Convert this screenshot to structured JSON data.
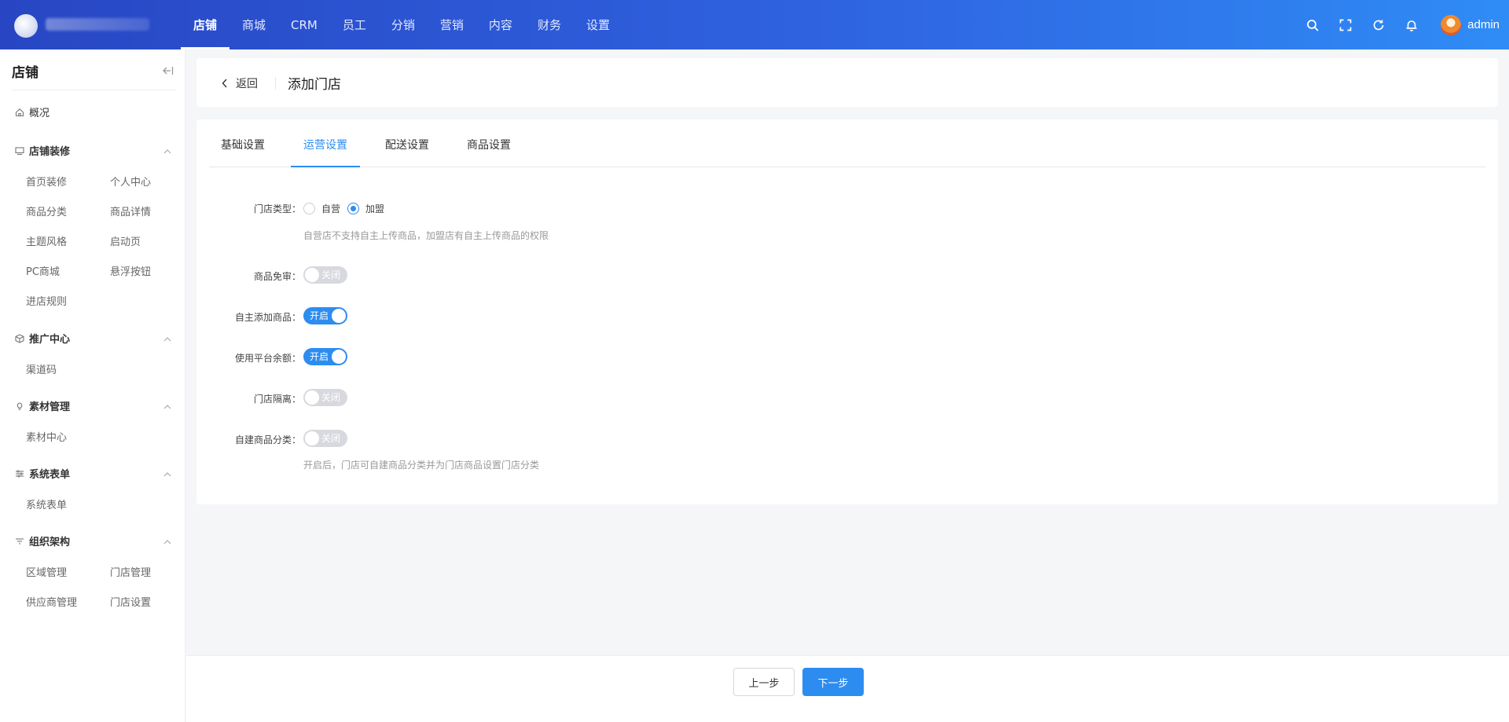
{
  "topbar": {
    "nav": [
      "店铺",
      "商城",
      "CRM",
      "员工",
      "分销",
      "营销",
      "内容",
      "财务",
      "设置"
    ],
    "active_index": 0,
    "user": "admin",
    "icons": [
      "search-icon",
      "fullscreen-icon",
      "refresh-icon",
      "bell-icon"
    ]
  },
  "sidebar": {
    "title": "店铺",
    "overview": "概况",
    "groups": [
      {
        "label": "店铺装修",
        "items": [
          "首页装修",
          "个人中心",
          "商品分类",
          "商品详情",
          "主题风格",
          "启动页",
          "PC商城",
          "悬浮按钮",
          "进店规则"
        ]
      },
      {
        "label": "推广中心",
        "items": [
          "渠道码"
        ]
      },
      {
        "label": "素材管理",
        "items": [
          "素材中心"
        ]
      },
      {
        "label": "系统表单",
        "items": [
          "系统表单"
        ]
      },
      {
        "label": "组织架构",
        "items": [
          "区域管理",
          "门店管理",
          "供应商管理",
          "门店设置"
        ]
      }
    ]
  },
  "header": {
    "back": "返回",
    "title": "添加门店"
  },
  "tabs": [
    "基础设置",
    "运营设置",
    "配送设置",
    "商品设置"
  ],
  "active_tab": 1,
  "form": {
    "store_type": {
      "label": "门店类型：",
      "options": [
        "自营",
        "加盟"
      ],
      "selected": "加盟",
      "hint": "自营店不支持自主上传商品，加盟店有自主上传商品的权限"
    },
    "switches": [
      {
        "label": "商品免审：",
        "on": false,
        "text": "关闭"
      },
      {
        "label": "自主添加商品：",
        "on": true,
        "text": "开启"
      },
      {
        "label": "使用平台余额：",
        "on": true,
        "text": "开启"
      },
      {
        "label": "门店隔离：",
        "on": false,
        "text": "关闭"
      },
      {
        "label": "自建商品分类：",
        "on": false,
        "text": "关闭"
      }
    ],
    "category_hint": "开启后，门店可自建商品分类并为门店商品设置门店分类"
  },
  "footer": {
    "prev": "上一步",
    "next": "下一步"
  },
  "colors": {
    "primary": "#2d8cf0",
    "topbar_start": "#2846c4",
    "topbar_end": "#2f8cf6"
  }
}
